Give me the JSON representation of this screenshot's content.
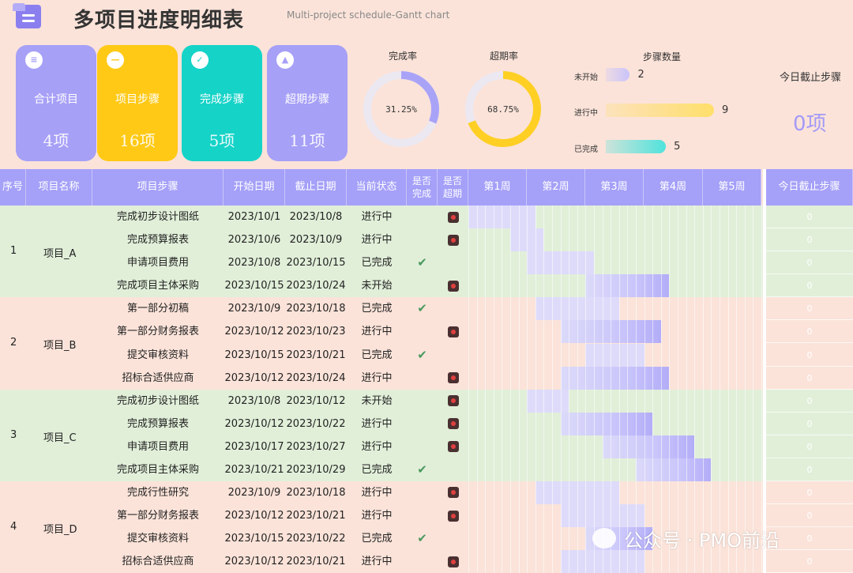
{
  "header": {
    "title": "多项目进度明细表",
    "subtitle": "Multi-project schedule-Gantt chart"
  },
  "cards": [
    {
      "label": "合计项目",
      "value": "4项",
      "color": "#a7a0f7",
      "icon": "list-icon"
    },
    {
      "label": "项目步骤",
      "value": "16项",
      "color": "#ffc916",
      "icon": "minus-icon"
    },
    {
      "label": "完成步骤",
      "value": "5项",
      "color": "#16d3c8",
      "icon": "check-icon"
    },
    {
      "label": "超期步骤",
      "value": "11项",
      "color": "#a7a0f7",
      "icon": "warning-icon"
    }
  ],
  "donuts": [
    {
      "title": "完成率",
      "value_text": "31.25%",
      "fraction": 0.3125,
      "color": "#a9a3f8"
    },
    {
      "title": "超期率",
      "value_text": "68.75%",
      "fraction": 0.6875,
      "color": "#ffcf24"
    }
  ],
  "steps_chart": {
    "title": "步骤数量",
    "items": [
      {
        "label": "未开始",
        "value": "2",
        "n": 2,
        "color": "#c9c3fb"
      },
      {
        "label": "进行中",
        "value": "9",
        "n": 9,
        "color": "#ffdf6a"
      },
      {
        "label": "已完成",
        "value": "5",
        "n": 5,
        "color": "#4fe3dc"
      }
    ]
  },
  "today": {
    "title": "今日截止步骤",
    "value": "0项"
  },
  "table": {
    "headers": {
      "seq": "序号",
      "project": "项目名称",
      "step": "项目步骤",
      "start": "开始日期",
      "end": "截止日期",
      "status": "当前状态",
      "done": "是否完成",
      "late": "是否超期",
      "today_col": "今日截止步骤"
    },
    "weeks": [
      "第1周",
      "第2周",
      "第3周",
      "第4周",
      "第5周"
    ],
    "groups": [
      {
        "seq": "1",
        "name": "项目_A",
        "bg": "#e1efd9",
        "rows": [
          {
            "step": "完成初步设计图纸",
            "start": "2023/10/1",
            "end": "2023/10/8",
            "status": "进行中",
            "done": false,
            "late": true,
            "s": 1,
            "e": 8
          },
          {
            "step": "完成预算报表",
            "start": "2023/10/6",
            "end": "2023/10/9",
            "status": "进行中",
            "done": false,
            "late": true,
            "s": 6,
            "e": 9
          },
          {
            "step": "申请项目费用",
            "start": "2023/10/8",
            "end": "2023/10/15",
            "status": "已完成",
            "done": true,
            "late": false,
            "s": 8,
            "e": 15
          },
          {
            "step": "完成项目主体采购",
            "start": "2023/10/15",
            "end": "2023/10/24",
            "status": "未开始",
            "done": false,
            "late": true,
            "s": 15,
            "e": 24
          }
        ]
      },
      {
        "seq": "2",
        "name": "项目_B",
        "bg": "#fbe3d9",
        "rows": [
          {
            "step": "第一部分初稿",
            "start": "2023/10/9",
            "end": "2023/10/18",
            "status": "已完成",
            "done": true,
            "late": false,
            "s": 9,
            "e": 18
          },
          {
            "step": "第一部分财务报表",
            "start": "2023/10/12",
            "end": "2023/10/23",
            "status": "进行中",
            "done": false,
            "late": true,
            "s": 12,
            "e": 23
          },
          {
            "step": "提交审核资料",
            "start": "2023/10/15",
            "end": "2023/10/21",
            "status": "已完成",
            "done": true,
            "late": false,
            "s": 15,
            "e": 21
          },
          {
            "step": "招标合适供应商",
            "start": "2023/10/12",
            "end": "2023/10/24",
            "status": "进行中",
            "done": false,
            "late": true,
            "s": 12,
            "e": 24
          }
        ]
      },
      {
        "seq": "3",
        "name": "项目_C",
        "bg": "#e1efd9",
        "rows": [
          {
            "step": "完成初步设计图纸",
            "start": "2023/10/8",
            "end": "2023/10/12",
            "status": "未开始",
            "done": false,
            "late": true,
            "s": 8,
            "e": 12
          },
          {
            "step": "完成预算报表",
            "start": "2023/10/12",
            "end": "2023/10/22",
            "status": "进行中",
            "done": false,
            "late": true,
            "s": 12,
            "e": 22
          },
          {
            "step": "申请项目费用",
            "start": "2023/10/17",
            "end": "2023/10/27",
            "status": "进行中",
            "done": false,
            "late": true,
            "s": 17,
            "e": 27
          },
          {
            "step": "完成项目主体采购",
            "start": "2023/10/21",
            "end": "2023/10/29",
            "status": "已完成",
            "done": true,
            "late": false,
            "s": 21,
            "e": 29
          }
        ]
      },
      {
        "seq": "4",
        "name": "项目_D",
        "bg": "#fbe3d9",
        "rows": [
          {
            "step": "完成行性研究",
            "start": "2023/10/9",
            "end": "2023/10/18",
            "status": "进行中",
            "done": false,
            "late": true,
            "s": 9,
            "e": 18
          },
          {
            "step": "第一部分财务报表",
            "start": "2023/10/12",
            "end": "2023/10/21",
            "status": "进行中",
            "done": false,
            "late": true,
            "s": 12,
            "e": 21
          },
          {
            "step": "提交审核资料",
            "start": "2023/10/15",
            "end": "2023/10/22",
            "status": "已完成",
            "done": true,
            "late": false,
            "s": 15,
            "e": 22
          },
          {
            "step": "招标合适供应商",
            "start": "2023/10/12",
            "end": "2023/10/21",
            "status": "进行中",
            "done": false,
            "late": true,
            "s": 12,
            "e": 21
          }
        ]
      }
    ],
    "today_values": [
      "0",
      "0",
      "0",
      "0",
      "0",
      "0",
      "0",
      "0",
      "0",
      "0",
      "0",
      "0",
      "0",
      "0",
      "0",
      "0"
    ]
  },
  "watermark": "公众号 · PMO前沿"
}
